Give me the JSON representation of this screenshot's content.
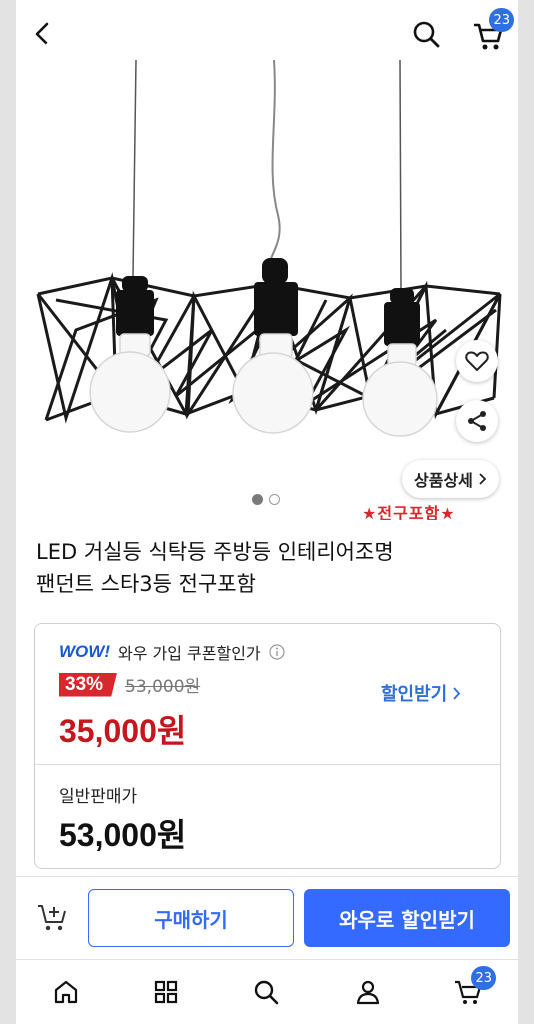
{
  "header": {
    "back_icon": "chevron-left-icon",
    "close_icon": "close-icon",
    "search_icon": "search-icon",
    "cart_icon": "cart-icon",
    "cart_count": "23"
  },
  "gallery": {
    "detail_link_label": "상품상세",
    "promo_overlay": "★전구포함★",
    "page_indicator": {
      "current": 1,
      "total": 2
    }
  },
  "product": {
    "title_line1": "LED 거실등 식탁등 주방등 인테리어조명",
    "title_line2": "팬던트 스타3등 전구포함"
  },
  "price": {
    "wow_logo": "WOW!",
    "wow_label": "와우 가입 쿠폰할인가",
    "discount_rate": "33%",
    "original_price": "53,000원",
    "wow_price": "35,000원",
    "coupon_link_label": "할인받기",
    "normal_label": "일반판매가",
    "normal_price": "53,000원"
  },
  "actions": {
    "buy_label": "구매하기",
    "wow_buy_label": "와우로 할인받기"
  },
  "bottom_nav": {
    "items": [
      "home-icon",
      "category-icon",
      "search-icon",
      "my-account-icon",
      "cart-icon"
    ],
    "cart_count": "23"
  },
  "colors": {
    "brand_blue": "#346aff",
    "discount_red": "#d8272d",
    "badge_blue": "#2f6fe4"
  }
}
